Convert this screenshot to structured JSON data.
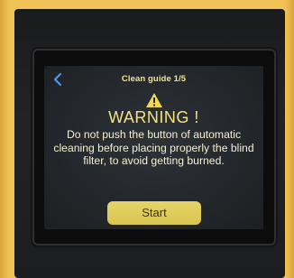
{
  "header": {
    "title": "Clean guide 1/5",
    "back_icon": "chevron-left-icon"
  },
  "warning": {
    "icon": "warning-triangle-icon",
    "heading": "WARNING !",
    "message": "Do not push the button of automatic cleaning before placing properly the blind filter, to avoid getting burned."
  },
  "actions": {
    "start_label": "Start"
  },
  "colors": {
    "accent": "#e0cd5c",
    "heading": "#f4e27f",
    "screen_bg": "#262a2e"
  }
}
